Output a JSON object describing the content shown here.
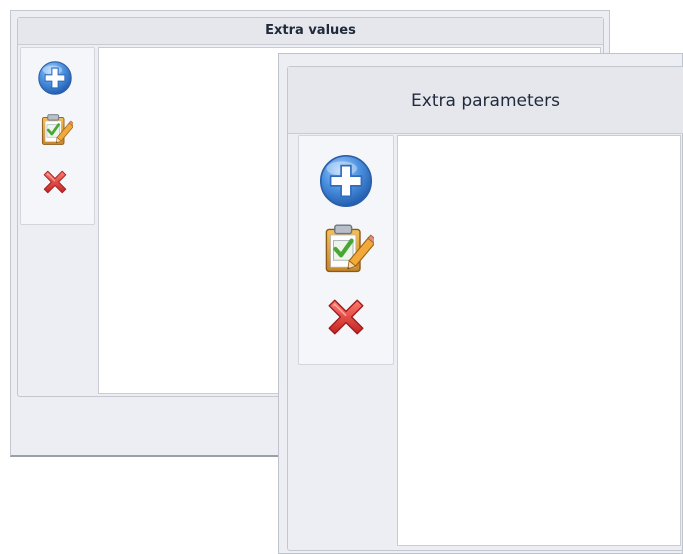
{
  "back_panel": {
    "title": "Extra values",
    "toolbar": [
      {
        "icon": "add-circle-icon"
      },
      {
        "icon": "clipboard-edit-icon"
      },
      {
        "icon": "delete-x-icon"
      }
    ]
  },
  "front_panel": {
    "title": "Extra parameters",
    "toolbar": [
      {
        "icon": "add-circle-icon"
      },
      {
        "icon": "clipboard-edit-icon"
      },
      {
        "icon": "delete-x-icon"
      }
    ]
  },
  "colors": {
    "panel_bg": "#eceef3",
    "add_blue": "#3f86d8",
    "delete_red": "#d23434",
    "check_green": "#46a832"
  }
}
